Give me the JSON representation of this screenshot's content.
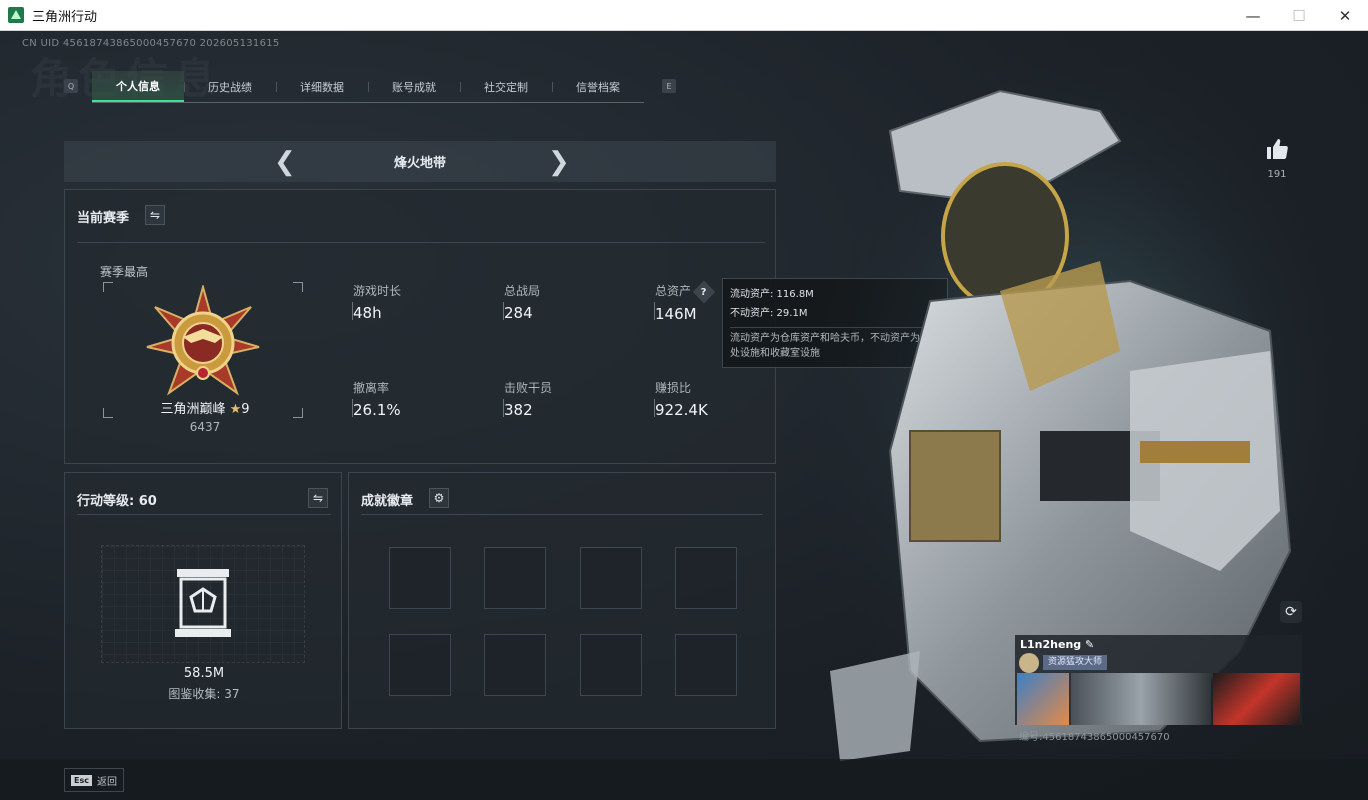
{
  "window": {
    "title": "三角洲行动"
  },
  "header": {
    "uid_line": "CN UID 4561874386500045767​0 202605131615",
    "watermark": "角色信息"
  },
  "tabs": {
    "left_key": "Q",
    "right_key": "E",
    "items": [
      {
        "label": "个人信息",
        "active": true
      },
      {
        "label": "历史战绩"
      },
      {
        "label": "详细数据"
      },
      {
        "label": "账号成就"
      },
      {
        "label": "社交定制"
      },
      {
        "label": "信誉档案"
      }
    ]
  },
  "map_switcher": {
    "name": "烽火地带",
    "prev_icon": "chevron-left-icon",
    "next_icon": "chevron-right-icon"
  },
  "season": {
    "title": "当前赛季",
    "best_label": "赛季最高",
    "rank_name": "三角洲巅峰",
    "rank_stars": "9",
    "rank_score": "6437",
    "stats": [
      {
        "label": "游戏时长",
        "value": "48h"
      },
      {
        "label": "总战局",
        "value": "284"
      },
      {
        "label": "总资产",
        "value": "146M"
      },
      {
        "label": "撤离率",
        "value": "26.1%"
      },
      {
        "label": "击败干员",
        "value": "382"
      },
      {
        "label": "赚损比",
        "value": "922.4K"
      }
    ]
  },
  "tooltip": {
    "liquid": "流动资产: 116.8M",
    "fixed": "不动资产: 29.1M",
    "desc": "流动资产为仓库资产和哈夫币，不动资产为特勤处设施和收藏室设施"
  },
  "level": {
    "title": "行动等级: 60",
    "value": "58.5M",
    "collection": "图鉴收集: 37"
  },
  "achievements": {
    "title": "成就徽章"
  },
  "profile": {
    "likes": "191",
    "username": "L1n2heng",
    "badge_title": "资源猛攻大师",
    "uid_bottom": "编号:4561874386500045767​0"
  },
  "footer": {
    "esc_key": "Esc",
    "back_label": "返回"
  },
  "colors": {
    "accent": "#3fe092",
    "panel": "#22292f",
    "background": "#1c2228"
  }
}
